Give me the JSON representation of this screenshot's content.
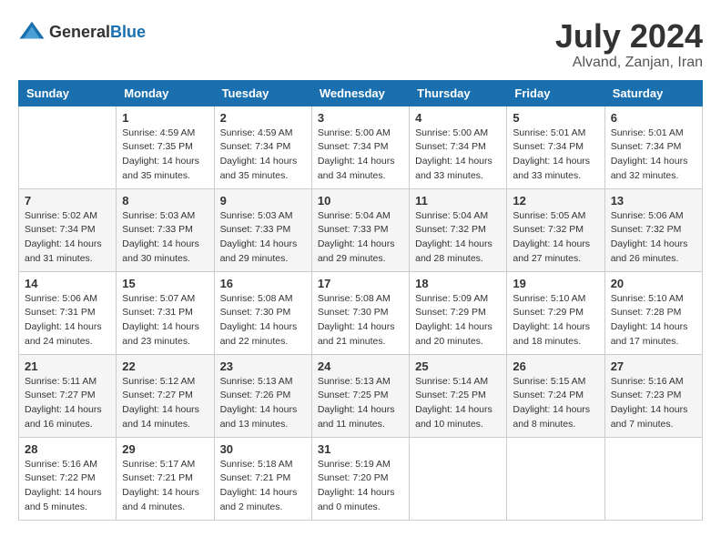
{
  "header": {
    "logo_general": "General",
    "logo_blue": "Blue",
    "month_title": "July 2024",
    "subtitle": "Alvand, Zanjan, Iran"
  },
  "days_of_week": [
    "Sunday",
    "Monday",
    "Tuesday",
    "Wednesday",
    "Thursday",
    "Friday",
    "Saturday"
  ],
  "weeks": [
    [
      {
        "day": "",
        "sunrise": "",
        "sunset": "",
        "daylight": ""
      },
      {
        "day": "1",
        "sunrise": "Sunrise: 4:59 AM",
        "sunset": "Sunset: 7:35 PM",
        "daylight": "Daylight: 14 hours and 35 minutes."
      },
      {
        "day": "2",
        "sunrise": "Sunrise: 4:59 AM",
        "sunset": "Sunset: 7:34 PM",
        "daylight": "Daylight: 14 hours and 35 minutes."
      },
      {
        "day": "3",
        "sunrise": "Sunrise: 5:00 AM",
        "sunset": "Sunset: 7:34 PM",
        "daylight": "Daylight: 14 hours and 34 minutes."
      },
      {
        "day": "4",
        "sunrise": "Sunrise: 5:00 AM",
        "sunset": "Sunset: 7:34 PM",
        "daylight": "Daylight: 14 hours and 33 minutes."
      },
      {
        "day": "5",
        "sunrise": "Sunrise: 5:01 AM",
        "sunset": "Sunset: 7:34 PM",
        "daylight": "Daylight: 14 hours and 33 minutes."
      },
      {
        "day": "6",
        "sunrise": "Sunrise: 5:01 AM",
        "sunset": "Sunset: 7:34 PM",
        "daylight": "Daylight: 14 hours and 32 minutes."
      }
    ],
    [
      {
        "day": "7",
        "sunrise": "Sunrise: 5:02 AM",
        "sunset": "Sunset: 7:34 PM",
        "daylight": "Daylight: 14 hours and 31 minutes."
      },
      {
        "day": "8",
        "sunrise": "Sunrise: 5:03 AM",
        "sunset": "Sunset: 7:33 PM",
        "daylight": "Daylight: 14 hours and 30 minutes."
      },
      {
        "day": "9",
        "sunrise": "Sunrise: 5:03 AM",
        "sunset": "Sunset: 7:33 PM",
        "daylight": "Daylight: 14 hours and 29 minutes."
      },
      {
        "day": "10",
        "sunrise": "Sunrise: 5:04 AM",
        "sunset": "Sunset: 7:33 PM",
        "daylight": "Daylight: 14 hours and 29 minutes."
      },
      {
        "day": "11",
        "sunrise": "Sunrise: 5:04 AM",
        "sunset": "Sunset: 7:32 PM",
        "daylight": "Daylight: 14 hours and 28 minutes."
      },
      {
        "day": "12",
        "sunrise": "Sunrise: 5:05 AM",
        "sunset": "Sunset: 7:32 PM",
        "daylight": "Daylight: 14 hours and 27 minutes."
      },
      {
        "day": "13",
        "sunrise": "Sunrise: 5:06 AM",
        "sunset": "Sunset: 7:32 PM",
        "daylight": "Daylight: 14 hours and 26 minutes."
      }
    ],
    [
      {
        "day": "14",
        "sunrise": "Sunrise: 5:06 AM",
        "sunset": "Sunset: 7:31 PM",
        "daylight": "Daylight: 14 hours and 24 minutes."
      },
      {
        "day": "15",
        "sunrise": "Sunrise: 5:07 AM",
        "sunset": "Sunset: 7:31 PM",
        "daylight": "Daylight: 14 hours and 23 minutes."
      },
      {
        "day": "16",
        "sunrise": "Sunrise: 5:08 AM",
        "sunset": "Sunset: 7:30 PM",
        "daylight": "Daylight: 14 hours and 22 minutes."
      },
      {
        "day": "17",
        "sunrise": "Sunrise: 5:08 AM",
        "sunset": "Sunset: 7:30 PM",
        "daylight": "Daylight: 14 hours and 21 minutes."
      },
      {
        "day": "18",
        "sunrise": "Sunrise: 5:09 AM",
        "sunset": "Sunset: 7:29 PM",
        "daylight": "Daylight: 14 hours and 20 minutes."
      },
      {
        "day": "19",
        "sunrise": "Sunrise: 5:10 AM",
        "sunset": "Sunset: 7:29 PM",
        "daylight": "Daylight: 14 hours and 18 minutes."
      },
      {
        "day": "20",
        "sunrise": "Sunrise: 5:10 AM",
        "sunset": "Sunset: 7:28 PM",
        "daylight": "Daylight: 14 hours and 17 minutes."
      }
    ],
    [
      {
        "day": "21",
        "sunrise": "Sunrise: 5:11 AM",
        "sunset": "Sunset: 7:27 PM",
        "daylight": "Daylight: 14 hours and 16 minutes."
      },
      {
        "day": "22",
        "sunrise": "Sunrise: 5:12 AM",
        "sunset": "Sunset: 7:27 PM",
        "daylight": "Daylight: 14 hours and 14 minutes."
      },
      {
        "day": "23",
        "sunrise": "Sunrise: 5:13 AM",
        "sunset": "Sunset: 7:26 PM",
        "daylight": "Daylight: 14 hours and 13 minutes."
      },
      {
        "day": "24",
        "sunrise": "Sunrise: 5:13 AM",
        "sunset": "Sunset: 7:25 PM",
        "daylight": "Daylight: 14 hours and 11 minutes."
      },
      {
        "day": "25",
        "sunrise": "Sunrise: 5:14 AM",
        "sunset": "Sunset: 7:25 PM",
        "daylight": "Daylight: 14 hours and 10 minutes."
      },
      {
        "day": "26",
        "sunrise": "Sunrise: 5:15 AM",
        "sunset": "Sunset: 7:24 PM",
        "daylight": "Daylight: 14 hours and 8 minutes."
      },
      {
        "day": "27",
        "sunrise": "Sunrise: 5:16 AM",
        "sunset": "Sunset: 7:23 PM",
        "daylight": "Daylight: 14 hours and 7 minutes."
      }
    ],
    [
      {
        "day": "28",
        "sunrise": "Sunrise: 5:16 AM",
        "sunset": "Sunset: 7:22 PM",
        "daylight": "Daylight: 14 hours and 5 minutes."
      },
      {
        "day": "29",
        "sunrise": "Sunrise: 5:17 AM",
        "sunset": "Sunset: 7:21 PM",
        "daylight": "Daylight: 14 hours and 4 minutes."
      },
      {
        "day": "30",
        "sunrise": "Sunrise: 5:18 AM",
        "sunset": "Sunset: 7:21 PM",
        "daylight": "Daylight: 14 hours and 2 minutes."
      },
      {
        "day": "31",
        "sunrise": "Sunrise: 5:19 AM",
        "sunset": "Sunset: 7:20 PM",
        "daylight": "Daylight: 14 hours and 0 minutes."
      },
      {
        "day": "",
        "sunrise": "",
        "sunset": "",
        "daylight": ""
      },
      {
        "day": "",
        "sunrise": "",
        "sunset": "",
        "daylight": ""
      },
      {
        "day": "",
        "sunrise": "",
        "sunset": "",
        "daylight": ""
      }
    ]
  ]
}
